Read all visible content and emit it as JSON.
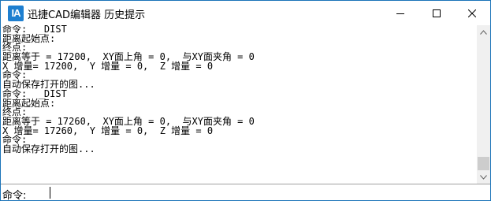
{
  "window": {
    "app_icon_text": "IA",
    "title": "迅捷CAD编辑器 历史提示"
  },
  "icons": {
    "minimize": "minimize-icon",
    "maximize": "maximize-icon",
    "close": "close-icon",
    "scroll_up": "chevron-up-icon",
    "scroll_down": "chevron-down-icon"
  },
  "output": {
    "lines": [
      "命令:  _DIST",
      "距离起始点:",
      "终点:",
      "距离等于 = 17200,  XY面上角 = 0,  与XY面夹角 = 0",
      "X 增量= 17200,  Y 增量 = 0,  Z 增量 = 0",
      "命令:",
      "自动保存打开的图...",
      "命令:  _DIST",
      "距离起始点:",
      "终点:",
      "距离等于 = 17260,  XY面上角 = 0,  与XY面夹角 = 0",
      "X 增量= 17260,  Y 增量 = 0,  Z 增量 = 0",
      "命令:",
      "自动保存打开的图..."
    ]
  },
  "command": {
    "label": "命令:",
    "value": ""
  }
}
